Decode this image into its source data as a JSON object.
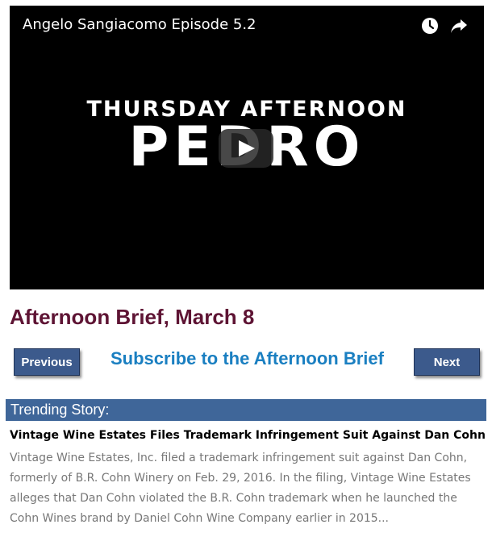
{
  "video": {
    "title": "Angelo Sangiacomo Episode 5.2",
    "brand_line1": "THURSDAY AFTERNOON",
    "brand_line2": "PEDRO"
  },
  "brief": {
    "title": "Afternoon Brief, March 8",
    "previous_label": "Previous",
    "next_label": "Next",
    "subscribe_label": "Subscribe to the Afternoon Brief"
  },
  "trending": {
    "label": "Trending Story",
    "label_suffix": ":",
    "headline": "Vintage Wine Estates Files Trademark Infringement Suit Against Dan Cohn",
    "body": "Vintage Wine Estates, Inc. filed a trademark infringement suit against Dan Cohn, formerly of B.R. Cohn Winery on Feb. 29, 2016. In the filing, Vintage Wine Estates alleges that Dan Cohn violated the B.R. Cohn trademark when he launched the Cohn Wines brand by Daniel Cohn Wine Company earlier in 2015..."
  },
  "colors": {
    "brief_title": "#5e1434",
    "button_bg": "#3c5a8c",
    "subscribe_link": "#1a7fc1",
    "trending_bar": "#3f6699",
    "body_text": "#777777"
  },
  "icons": {
    "clock": "clock-icon",
    "share": "share-icon",
    "play": "play-icon"
  }
}
